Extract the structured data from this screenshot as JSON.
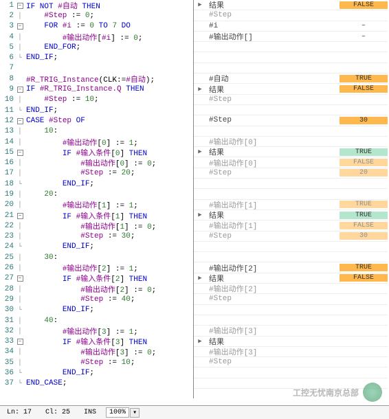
{
  "code_lines": [
    {
      "n": 1,
      "fold": "minus",
      "indent": 0,
      "tokens": [
        [
          "kw",
          "IF NOT "
        ],
        [
          "var",
          "#自动"
        ],
        [
          "kw",
          " THEN"
        ]
      ]
    },
    {
      "n": 2,
      "fold": "bar",
      "indent": 1,
      "tokens": [
        [
          "var",
          "#Step"
        ],
        [
          "",
          " := "
        ],
        [
          "num",
          "0"
        ],
        [
          "",
          ";"
        ]
      ]
    },
    {
      "n": 3,
      "fold": "minus",
      "indent": 1,
      "tokens": [
        [
          "kw",
          "FOR "
        ],
        [
          "var",
          "#i"
        ],
        [
          "",
          " := "
        ],
        [
          "num",
          "0"
        ],
        [
          "kw",
          " TO "
        ],
        [
          "num",
          "7"
        ],
        [
          "kw",
          " DO"
        ]
      ]
    },
    {
      "n": 4,
      "fold": "bar",
      "indent": 2,
      "tokens": [
        [
          "var",
          "#输出动作"
        ],
        [
          "",
          "["
        ],
        [
          "var",
          "#i"
        ],
        [
          "",
          "] := "
        ],
        [
          "num",
          "0"
        ],
        [
          "",
          ";"
        ]
      ]
    },
    {
      "n": 5,
      "fold": "bar",
      "indent": 1,
      "tokens": [
        [
          "kw",
          "END_FOR"
        ],
        [
          "",
          ";"
        ]
      ]
    },
    {
      "n": 6,
      "fold": "end",
      "indent": 0,
      "tokens": [
        [
          "kw",
          "END_IF"
        ],
        [
          "",
          ";"
        ]
      ]
    },
    {
      "n": 7,
      "fold": "",
      "indent": 0,
      "tokens": []
    },
    {
      "n": 8,
      "fold": "",
      "indent": 0,
      "tokens": [
        [
          "var",
          "#R_TRIG_Instance"
        ],
        [
          "",
          "(CLK:="
        ],
        [
          "var",
          "#自动"
        ],
        [
          "",
          ");"
        ]
      ]
    },
    {
      "n": 9,
      "fold": "minus",
      "indent": 0,
      "tokens": [
        [
          "kw",
          "IF "
        ],
        [
          "var",
          "#R_TRIG_Instance.Q"
        ],
        [
          "kw",
          " THEN"
        ]
      ]
    },
    {
      "n": 10,
      "fold": "bar",
      "indent": 1,
      "tokens": [
        [
          "var",
          "#Step"
        ],
        [
          "",
          " := "
        ],
        [
          "num",
          "10"
        ],
        [
          "",
          ";"
        ]
      ]
    },
    {
      "n": 11,
      "fold": "end",
      "indent": 0,
      "tokens": [
        [
          "kw",
          "END_IF"
        ],
        [
          "",
          ";"
        ]
      ]
    },
    {
      "n": 12,
      "fold": "minus",
      "indent": 0,
      "tokens": [
        [
          "kw",
          "CASE "
        ],
        [
          "var",
          "#Step"
        ],
        [
          "kw",
          " OF"
        ]
      ]
    },
    {
      "n": 13,
      "fold": "bar",
      "indent": 1,
      "tokens": [
        [
          "num",
          "10"
        ],
        [
          "",
          ":"
        ]
      ]
    },
    {
      "n": 14,
      "fold": "bar",
      "indent": 2,
      "tokens": [
        [
          "var",
          "#输出动作"
        ],
        [
          "",
          "["
        ],
        [
          "num",
          "0"
        ],
        [
          "",
          "] := "
        ],
        [
          "num",
          "1"
        ],
        [
          "",
          ";"
        ]
      ]
    },
    {
      "n": 15,
      "fold": "minus",
      "indent": 2,
      "tokens": [
        [
          "kw",
          "IF "
        ],
        [
          "var",
          "#输入条件"
        ],
        [
          "",
          "["
        ],
        [
          "num",
          "0"
        ],
        [
          "",
          "]"
        ],
        [
          "kw",
          " THEN"
        ]
      ]
    },
    {
      "n": 16,
      "fold": "bar",
      "indent": 3,
      "tokens": [
        [
          "var",
          "#输出动作"
        ],
        [
          "",
          "["
        ],
        [
          "num",
          "0"
        ],
        [
          "",
          "] := "
        ],
        [
          "num",
          "0"
        ],
        [
          "",
          ";"
        ]
      ]
    },
    {
      "n": 17,
      "fold": "bar",
      "indent": 3,
      "tokens": [
        [
          "var",
          "#Step"
        ],
        [
          "",
          " := "
        ],
        [
          "num",
          "20"
        ],
        [
          "",
          ";"
        ]
      ]
    },
    {
      "n": 18,
      "fold": "end",
      "indent": 2,
      "tokens": [
        [
          "kw",
          "END_IF"
        ],
        [
          "",
          ";"
        ]
      ]
    },
    {
      "n": 19,
      "fold": "bar",
      "indent": 1,
      "tokens": [
        [
          "num",
          "20"
        ],
        [
          "",
          ":"
        ]
      ]
    },
    {
      "n": 20,
      "fold": "bar",
      "indent": 2,
      "tokens": [
        [
          "var",
          "#输出动作"
        ],
        [
          "",
          "["
        ],
        [
          "num",
          "1"
        ],
        [
          "",
          "] := "
        ],
        [
          "num",
          "1"
        ],
        [
          "",
          ";"
        ]
      ]
    },
    {
      "n": 21,
      "fold": "minus",
      "indent": 2,
      "tokens": [
        [
          "kw",
          "IF "
        ],
        [
          "var",
          "#输入条件"
        ],
        [
          "",
          "["
        ],
        [
          "num",
          "1"
        ],
        [
          "",
          "]"
        ],
        [
          "kw",
          " THEN"
        ]
      ]
    },
    {
      "n": 22,
      "fold": "bar",
      "indent": 3,
      "tokens": [
        [
          "var",
          "#输出动作"
        ],
        [
          "",
          "["
        ],
        [
          "num",
          "1"
        ],
        [
          "",
          "] := "
        ],
        [
          "num",
          "0"
        ],
        [
          "",
          ";"
        ]
      ]
    },
    {
      "n": 23,
      "fold": "bar",
      "indent": 3,
      "tokens": [
        [
          "var",
          "#Step"
        ],
        [
          "",
          " := "
        ],
        [
          "num",
          "30"
        ],
        [
          "",
          ";"
        ]
      ]
    },
    {
      "n": 24,
      "fold": "end",
      "indent": 2,
      "tokens": [
        [
          "kw",
          "END_IF"
        ],
        [
          "",
          ";"
        ]
      ]
    },
    {
      "n": 25,
      "fold": "bar",
      "indent": 1,
      "tokens": [
        [
          "num",
          "30"
        ],
        [
          "",
          ":"
        ]
      ]
    },
    {
      "n": 26,
      "fold": "bar",
      "indent": 2,
      "tokens": [
        [
          "var",
          "#输出动作"
        ],
        [
          "",
          "["
        ],
        [
          "num",
          "2"
        ],
        [
          "",
          "] := "
        ],
        [
          "num",
          "1"
        ],
        [
          "",
          ";"
        ]
      ]
    },
    {
      "n": 27,
      "fold": "minus",
      "indent": 2,
      "tokens": [
        [
          "kw",
          "IF "
        ],
        [
          "var",
          "#输入条件"
        ],
        [
          "",
          "["
        ],
        [
          "num",
          "2"
        ],
        [
          "",
          "]"
        ],
        [
          "kw",
          " THEN"
        ]
      ]
    },
    {
      "n": 28,
      "fold": "bar",
      "indent": 3,
      "tokens": [
        [
          "var",
          "#输出动作"
        ],
        [
          "",
          "["
        ],
        [
          "num",
          "2"
        ],
        [
          "",
          "] := "
        ],
        [
          "num",
          "0"
        ],
        [
          "",
          ";"
        ]
      ]
    },
    {
      "n": 29,
      "fold": "bar",
      "indent": 3,
      "tokens": [
        [
          "var",
          "#Step"
        ],
        [
          "",
          " := "
        ],
        [
          "num",
          "40"
        ],
        [
          "",
          ";"
        ]
      ]
    },
    {
      "n": 30,
      "fold": "end",
      "indent": 2,
      "tokens": [
        [
          "kw",
          "END_IF"
        ],
        [
          "",
          ";"
        ]
      ]
    },
    {
      "n": 31,
      "fold": "bar",
      "indent": 1,
      "tokens": [
        [
          "num",
          "40"
        ],
        [
          "",
          ":"
        ]
      ]
    },
    {
      "n": 32,
      "fold": "bar",
      "indent": 2,
      "tokens": [
        [
          "var",
          "#输出动作"
        ],
        [
          "",
          "["
        ],
        [
          "num",
          "3"
        ],
        [
          "",
          "] := "
        ],
        [
          "num",
          "1"
        ],
        [
          "",
          ";"
        ]
      ]
    },
    {
      "n": 33,
      "fold": "minus",
      "indent": 2,
      "tokens": [
        [
          "kw",
          "IF "
        ],
        [
          "var",
          "#输入条件"
        ],
        [
          "",
          "["
        ],
        [
          "num",
          "3"
        ],
        [
          "",
          "]"
        ],
        [
          "kw",
          " THEN"
        ]
      ]
    },
    {
      "n": 34,
      "fold": "bar",
      "indent": 3,
      "tokens": [
        [
          "var",
          "#输出动作"
        ],
        [
          "",
          "["
        ],
        [
          "num",
          "3"
        ],
        [
          "",
          "] := "
        ],
        [
          "num",
          "0"
        ],
        [
          "",
          ";"
        ]
      ]
    },
    {
      "n": 35,
      "fold": "bar",
      "indent": 3,
      "tokens": [
        [
          "var",
          "#Step"
        ],
        [
          "",
          " := "
        ],
        [
          "num",
          "10"
        ],
        [
          "",
          ";"
        ]
      ]
    },
    {
      "n": 36,
      "fold": "end",
      "indent": 2,
      "tokens": [
        [
          "kw",
          "END_IF"
        ],
        [
          "",
          ";"
        ]
      ]
    },
    {
      "n": 37,
      "fold": "end",
      "indent": 0,
      "tokens": [
        [
          "kw",
          "END_CASE"
        ],
        [
          "",
          ";"
        ]
      ]
    }
  ],
  "watch_lines": [
    {
      "icon": "▶",
      "name": "结果",
      "val": "FALSE",
      "style": "orange"
    },
    {
      "icon": "",
      "name": "#Step",
      "dim": true,
      "val": "",
      "style": ""
    },
    {
      "icon": "",
      "name": "#i",
      "val": "–",
      "style": "dash"
    },
    {
      "icon": "",
      "name": "#输出动作[]",
      "val": "–",
      "style": "dash"
    },
    {
      "icon": "",
      "name": "",
      "val": "",
      "style": ""
    },
    {
      "icon": "",
      "name": "",
      "val": "",
      "style": ""
    },
    {
      "icon": "",
      "name": "",
      "val": "",
      "style": ""
    },
    {
      "icon": "",
      "name": "#自动",
      "val": "TRUE",
      "style": "orange"
    },
    {
      "icon": "▶",
      "name": "结果",
      "val": "FALSE",
      "style": "orange"
    },
    {
      "icon": "",
      "name": "#Step",
      "dim": true,
      "val": "",
      "style": ""
    },
    {
      "icon": "",
      "name": "",
      "val": "",
      "style": ""
    },
    {
      "icon": "",
      "name": "#Step",
      "val": "30",
      "style": "orange"
    },
    {
      "icon": "",
      "name": "",
      "val": "",
      "style": ""
    },
    {
      "icon": "",
      "name": "#输出动作[0]",
      "dim": true,
      "val": "",
      "style": ""
    },
    {
      "icon": "▶",
      "name": "结果",
      "val": "TRUE",
      "style": "green"
    },
    {
      "icon": "",
      "name": "#输出动作[0]",
      "dim": true,
      "val": "FALSE",
      "style": "orange",
      "dimval": true
    },
    {
      "icon": "",
      "name": "#Step",
      "dim": true,
      "val": "20",
      "style": "orange",
      "dimval": true
    },
    {
      "icon": "",
      "name": "",
      "val": "",
      "style": ""
    },
    {
      "icon": "",
      "name": "",
      "val": "",
      "style": ""
    },
    {
      "icon": "",
      "name": "#输出动作[1]",
      "dim": true,
      "val": "TRUE",
      "style": "orange",
      "dimval": true
    },
    {
      "icon": "▶",
      "name": "结果",
      "val": "TRUE",
      "style": "green"
    },
    {
      "icon": "",
      "name": "#输出动作[1]",
      "dim": true,
      "val": "FALSE",
      "style": "orange",
      "dimval": true
    },
    {
      "icon": "",
      "name": "#Step",
      "dim": true,
      "val": "30",
      "style": "orange",
      "dimval": true
    },
    {
      "icon": "",
      "name": "",
      "val": "",
      "style": ""
    },
    {
      "icon": "",
      "name": "",
      "val": "",
      "style": ""
    },
    {
      "icon": "",
      "name": "#输出动作[2]",
      "val": "TRUE",
      "style": "orange"
    },
    {
      "icon": "▶",
      "name": "结果",
      "val": "FALSE",
      "style": "orange"
    },
    {
      "icon": "",
      "name": "#输出动作[2]",
      "dim": true,
      "val": "",
      "style": ""
    },
    {
      "icon": "",
      "name": "#Step",
      "dim": true,
      "val": "",
      "style": ""
    },
    {
      "icon": "",
      "name": "",
      "val": "",
      "style": ""
    },
    {
      "icon": "",
      "name": "",
      "val": "",
      "style": ""
    },
    {
      "icon": "",
      "name": "#输出动作[3]",
      "dim": true,
      "val": "",
      "style": ""
    },
    {
      "icon": "▶",
      "name": "结果",
      "val": "",
      "style": ""
    },
    {
      "icon": "",
      "name": "#输出动作[3]",
      "dim": true,
      "val": "",
      "style": ""
    },
    {
      "icon": "",
      "name": "#Step",
      "dim": true,
      "val": "",
      "style": ""
    },
    {
      "icon": "",
      "name": "",
      "val": "",
      "style": ""
    },
    {
      "icon": "",
      "name": "",
      "val": "",
      "style": ""
    }
  ],
  "status": {
    "ln_label": "Ln: 17",
    "cl_label": "Cl: 25",
    "ins": "INS",
    "zoom": "100%"
  },
  "watermark": "工控无忧南京总部"
}
